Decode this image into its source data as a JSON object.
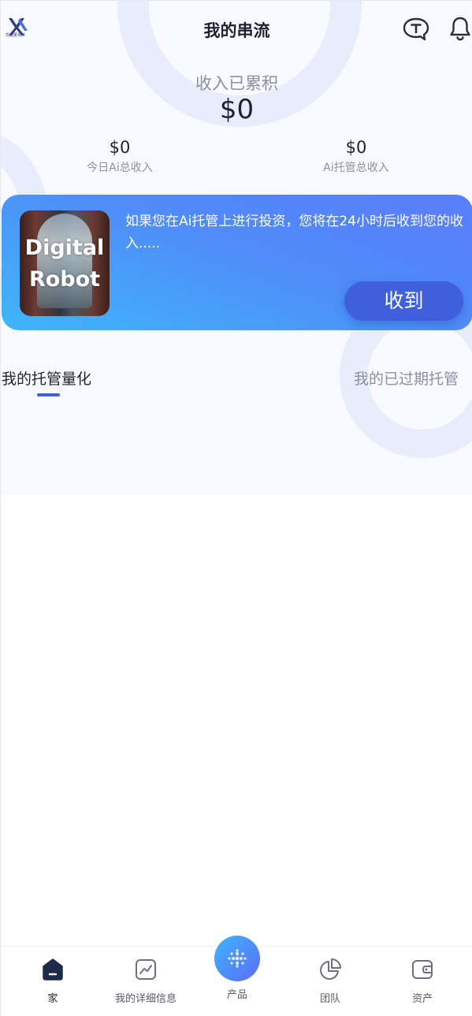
{
  "header": {
    "title": "我的串流",
    "logo_caption": "优选量化所",
    "icons": {
      "logo": "logo-icon",
      "chat": "chat-t-icon",
      "notifications": "bell-icon"
    }
  },
  "stats": {
    "total_label": "收入已累积",
    "total_value": "$0",
    "today": {
      "value": "$0",
      "label": "今日Ai总收入"
    },
    "hosted": {
      "value": "$0",
      "label": "Ai托管总收入"
    }
  },
  "banner": {
    "image_text_line1": "Digital",
    "image_text_line2": "Robot",
    "message": "如果您在Ai托管上进行投资，您将在24小时后收到您的收入.....",
    "button_label": "收到"
  },
  "tabs": [
    {
      "label": "我的托管量化",
      "active": true
    },
    {
      "label": "我的已过期托管",
      "active": false
    }
  ],
  "bottom_nav": [
    {
      "label": "家",
      "icon": "home-icon",
      "active": true
    },
    {
      "label": "我的详细信息",
      "icon": "chart-icon",
      "active": false
    },
    {
      "label": "产品",
      "icon": "product-dots-icon",
      "active": false
    },
    {
      "label": "团队",
      "icon": "pie-chart-icon",
      "active": false
    },
    {
      "label": "资产",
      "icon": "wallet-icon",
      "active": false
    }
  ],
  "colors": {
    "accent": "#3f5fdd",
    "banner_start": "#5a7dfb",
    "banner_end": "#3fb6fb",
    "background": "#f8faff"
  }
}
